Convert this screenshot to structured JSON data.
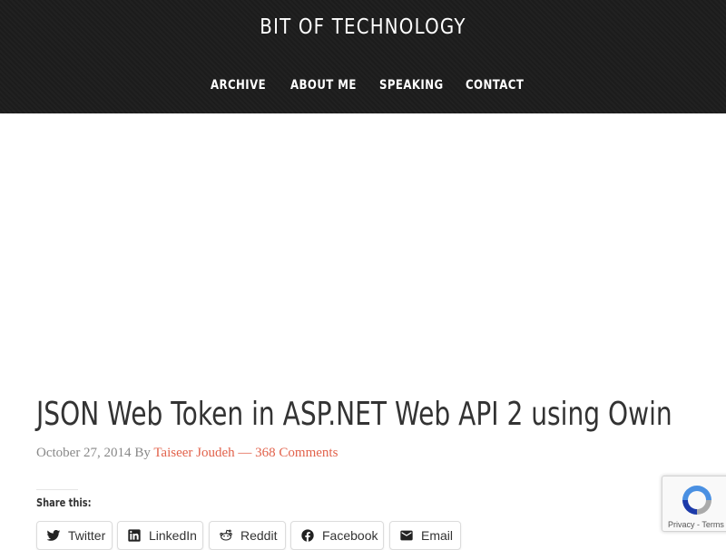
{
  "header": {
    "site_title": "BIT OF TECHNOLOGY",
    "nav": [
      "ARCHIVE",
      "ABOUT ME",
      "SPEAKING",
      "CONTACT"
    ]
  },
  "post": {
    "title": "JSON Web Token in ASP.NET Web API 2 using Owin",
    "date": "October 27, 2014",
    "by": "By",
    "author": "Taiseer Joudeh",
    "separator": "—",
    "comments": "368 Comments"
  },
  "share": {
    "label": "Share this:",
    "buttons": [
      {
        "label": "Twitter",
        "icon": "twitter-icon"
      },
      {
        "label": "LinkedIn",
        "icon": "linkedin-icon"
      },
      {
        "label": "Reddit",
        "icon": "reddit-icon"
      },
      {
        "label": "Facebook",
        "icon": "facebook-icon"
      },
      {
        "label": "Email",
        "icon": "email-icon"
      }
    ]
  },
  "recaptcha": {
    "privacy": "Privacy",
    "dash": "-",
    "terms": "Terms"
  },
  "colors": {
    "header_bg": "#1c1c1c",
    "accent_link": "#e2624b",
    "meta_text": "#888888",
    "title_text": "#333333"
  }
}
